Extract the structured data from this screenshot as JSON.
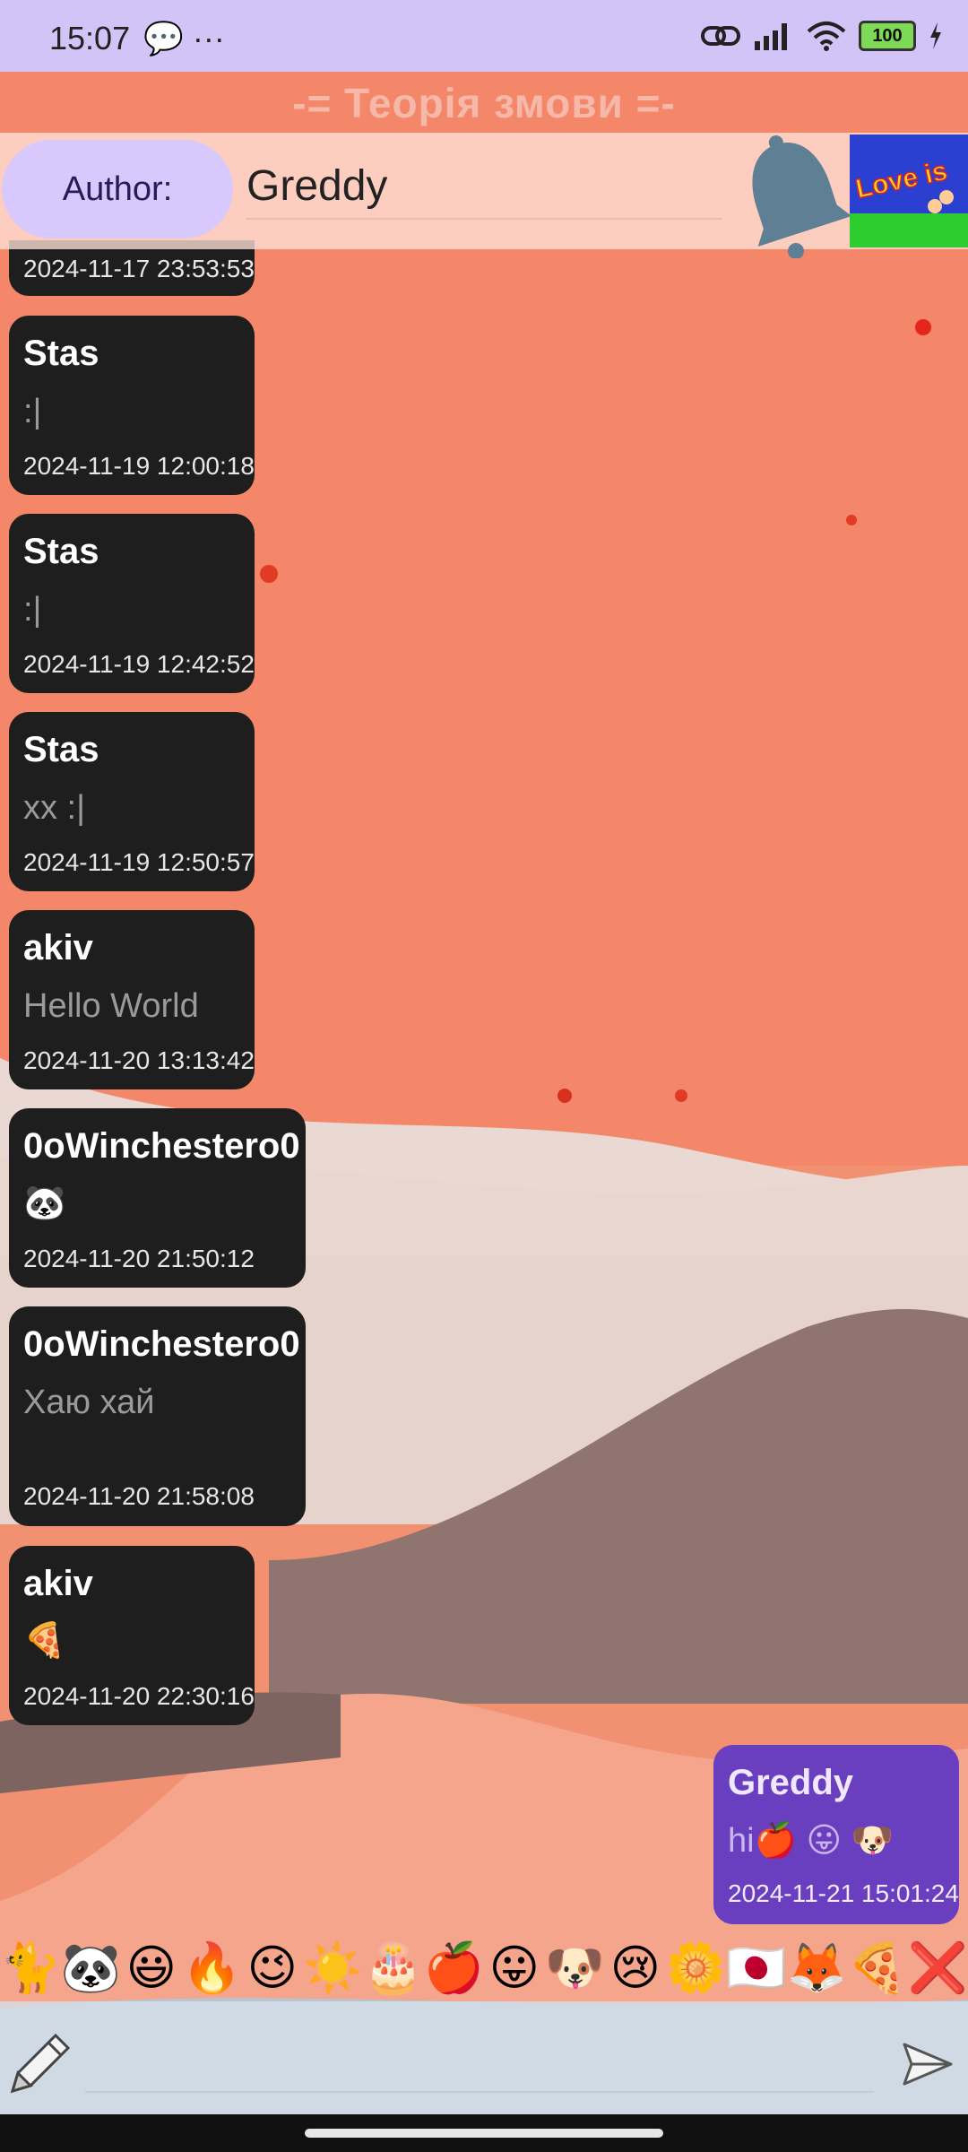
{
  "status_bar": {
    "time": "15:07",
    "left_icons": "💬 ···",
    "battery": "100"
  },
  "chat_title": "-= Теорія змови =-",
  "author_row": {
    "label": "Author:",
    "value": "Greddy"
  },
  "messages": [
    {
      "author": "Stas",
      "text": ":|",
      "time": "2024-11-19 12:00:18"
    },
    {
      "author": "Stas",
      "text": ":|",
      "time": "2024-11-19 12:42:52"
    },
    {
      "author": "Stas",
      "text": "xx :|",
      "time": "2024-11-19 12:50:57"
    },
    {
      "author": "akiv",
      "text": "Hello World",
      "time": "2024-11-20 13:13:42"
    },
    {
      "author": "0oWinchestero0",
      "text": "🐼",
      "time": "2024-11-20 21:50:12"
    },
    {
      "author": "0oWinchestero0",
      "text": "Хаю хай",
      "time": "2024-11-20 21:58:08"
    },
    {
      "author": "akiv",
      "text": "🍕",
      "time": "2024-11-20 22:30:16"
    }
  ],
  "partial_message_time": "2024-11-17 23:53:53",
  "own_message": {
    "author": "Greddy",
    "text": "hi🍎 😛 🐶",
    "time": "2024-11-21 15:01:24"
  },
  "emoji_bar": [
    "🐈",
    "🐼",
    "😃",
    "🔥",
    "😉",
    "☀️",
    "🎂",
    "🍎",
    "😛",
    "🐶",
    "😢",
    "🌼",
    "🇯🇵",
    "🦊",
    "🍕",
    "❌"
  ],
  "icons": {
    "bell": "bell-icon",
    "pencil": "pencil-icon",
    "send": "send-icon",
    "image": "love-is-image"
  },
  "colors": {
    "status_bar_bg": "#d3c4f8",
    "message_bg": "#1e1e1e",
    "own_message_bg": "#6a3fbf",
    "author_button_bg": "#d9c8fb"
  }
}
